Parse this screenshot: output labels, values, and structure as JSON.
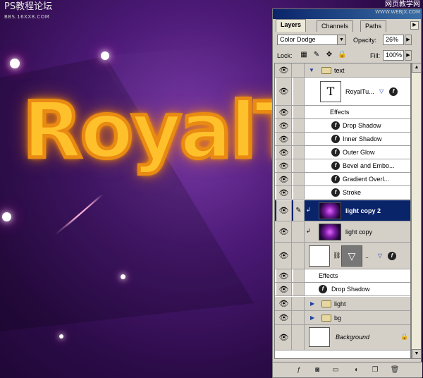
{
  "watermarks": {
    "top_left": "PS教程论坛",
    "top_left_sub": "BBS.16XX8.COM",
    "top_right": "网页教学网",
    "top_right_sub": "WWW.WEBJX.COM"
  },
  "artwork": {
    "headline": "RoyalTu",
    "accent": "#ffc12b",
    "background": "#4c1a77"
  },
  "panel": {
    "tabs": [
      "Layers",
      "Channels",
      "Paths"
    ],
    "blend_mode": "Color Dodge",
    "opacity_label": "Opacity:",
    "opacity_value": "26%",
    "lock_label": "Lock:",
    "fill_label": "Fill:",
    "fill_value": "100%",
    "layers": {
      "text_group": "text",
      "text_layer": "RoyalTu...",
      "text_layer_thumb": "T",
      "effects_label": "Effects",
      "effects": [
        "Drop Shadow",
        "Inner Shadow",
        "Outer Glow",
        "Bevel and Embo...",
        "Gradient Overl...",
        "Stroke"
      ],
      "light_copy_2": "light copy 2",
      "light_copy": "light copy",
      "shape_layer_name": "..",
      "shape_effects_label": "Effects",
      "shape_effect": "Drop Shadow",
      "light_group": "light",
      "bg_group": "bg",
      "background": "Background"
    },
    "selected_color": "#0a246a"
  }
}
